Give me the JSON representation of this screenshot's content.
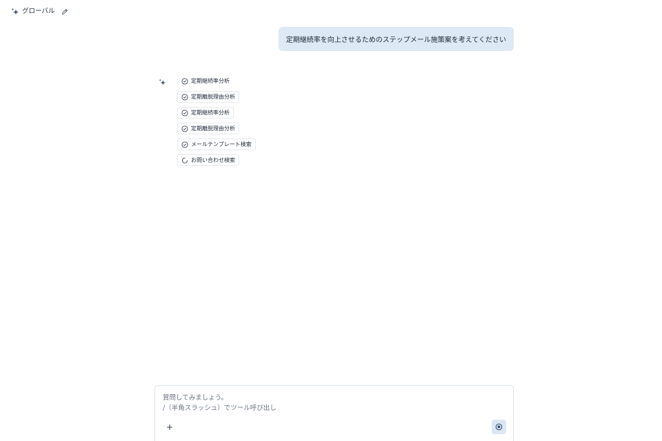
{
  "header": {
    "title": "グローバル",
    "sparkle_icon": "sparkle-icon",
    "edit_icon": "pencil-icon"
  },
  "conversation": {
    "user_message": "定期継続率を向上させるためのステップメール施策案を考えてください",
    "assistant_icon": "sparkle-icon",
    "steps": [
      {
        "label": "定期継続率分析",
        "status": "done",
        "bordered": false
      },
      {
        "label": "定期離脱理由分析",
        "status": "done",
        "bordered": true
      },
      {
        "label": "定期継続率分析",
        "status": "done",
        "bordered": true
      },
      {
        "label": "定期離脱理由分析",
        "status": "done",
        "bordered": true
      },
      {
        "label": "メールテンプレート検索",
        "status": "done",
        "bordered": true
      },
      {
        "label": "お問い合わせ検索",
        "status": "loading",
        "bordered": true
      }
    ]
  },
  "composer": {
    "placeholder_line1": "質問してみましょう。",
    "placeholder_line2": "/（半角スラッシュ）でツール呼び出し",
    "add_icon": "plus-icon",
    "stop_icon": "stop-icon"
  },
  "colors": {
    "user_bubble": "#dde9f4",
    "sparkle": "#2f4a6b",
    "stop_button": "#dbe7f2"
  }
}
